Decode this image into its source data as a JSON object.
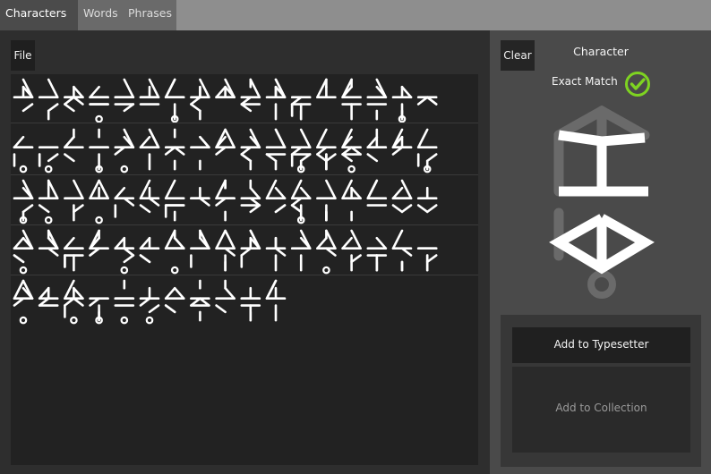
{
  "tabs": [
    {
      "label": "Characters",
      "active": true
    },
    {
      "label": "Words",
      "active": false
    },
    {
      "label": "Phrases",
      "active": false
    }
  ],
  "toolbar": {
    "file_label": "File"
  },
  "glyph_grid": {
    "rows": 5,
    "glyph_counts": [
      17,
      17,
      17,
      17,
      11
    ]
  },
  "right_panel": {
    "clear_label": "Clear",
    "title": "Character",
    "match_label": "Exact Match",
    "match_icon": "check-circle-icon"
  },
  "actions": {
    "add_typesetter": "Add to Typesetter",
    "add_collection": "Add to Collection"
  },
  "colors": {
    "accent_green": "#7ed321",
    "glyph_white": "#ffffff"
  }
}
